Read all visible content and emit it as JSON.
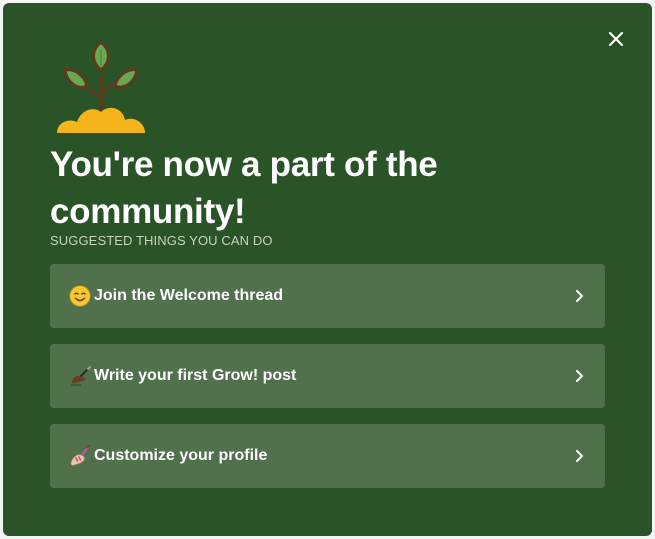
{
  "modal": {
    "title": "You're now a part of the community!",
    "subtitle": "SUGGESTED THINGS YOU CAN DO",
    "close_icon": "close-icon",
    "hero_icon": "sprout-icon",
    "colors": {
      "background": "#2b5328",
      "card": "#50714c",
      "subtitle": "#c7d3c3"
    }
  },
  "actions": [
    {
      "icon": "smiling-face-icon",
      "label": "Join the Welcome thread"
    },
    {
      "icon": "writing-hand-icon",
      "label": "Write your first Grow! post"
    },
    {
      "icon": "nail-polish-icon",
      "label": "Customize your profile"
    }
  ]
}
